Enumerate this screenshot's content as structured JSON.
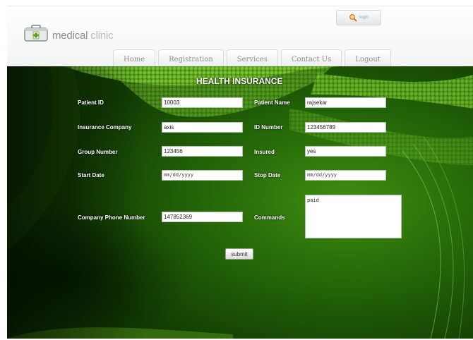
{
  "header": {
    "brand_main": "medical",
    "brand_sub": "clinic",
    "search_label": "login"
  },
  "nav": [
    "Home",
    "Registration",
    "Services",
    "Contact Us",
    "Logout"
  ],
  "form": {
    "title": "HEALTH INSURANCE",
    "patient_id_label": "Patient ID",
    "patient_id_value": "10003",
    "patient_name_label": "Patient Name",
    "patient_name_value": "rajsekar",
    "insurance_company_label": "Insurance Company",
    "insurance_company_value": "axis",
    "id_number_label": "ID Number",
    "id_number_value": "123456789",
    "group_number_label": "Group Number",
    "group_number_value": "123456",
    "insured_label": "Insured",
    "insured_value": "yes",
    "start_date_label": "Start Date",
    "start_date_placeholder": "mm/dd/yyyy",
    "stop_date_label": "Stop Date",
    "stop_date_placeholder": "mm/dd/yyyy",
    "company_phone_label": "Company Phone Number",
    "company_phone_value": "147852369",
    "commands_label": "Commands",
    "commands_value": "paid",
    "submit_label": "submit"
  },
  "colors": {
    "accent_green": "#2b6e0b",
    "deep_green": "#0d2f02"
  }
}
